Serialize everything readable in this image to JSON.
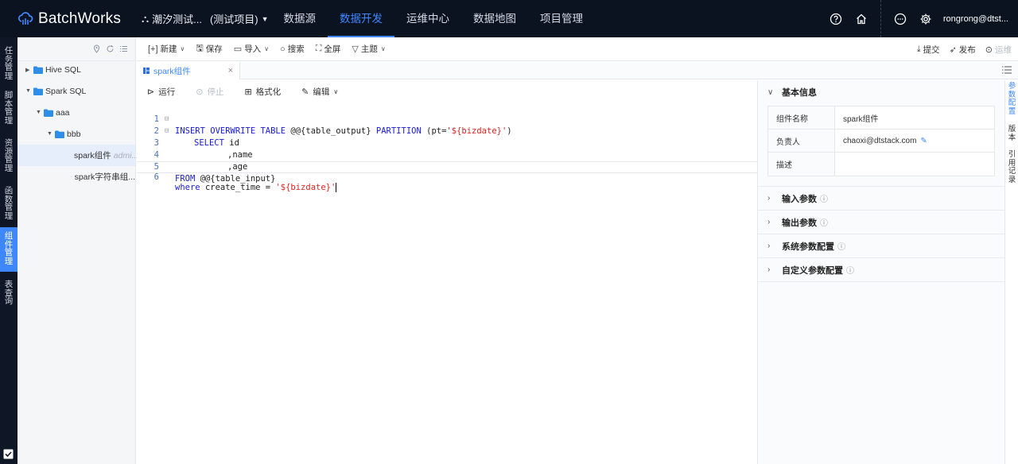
{
  "app": {
    "name": "BatchWorks",
    "project": "潮汐测试...",
    "project_tag": "(测试项目)",
    "user": "rongrong@dtst..."
  },
  "topnav": [
    "数据源",
    "数据开发",
    "运维中心",
    "数据地图",
    "项目管理"
  ],
  "leftbar": [
    [
      "任",
      "务",
      "管",
      "理"
    ],
    [
      "脚",
      "本",
      "管",
      "理"
    ],
    [
      "资",
      "源",
      "管",
      "理"
    ],
    [
      "函",
      "数",
      "管",
      "理"
    ],
    [
      "组",
      "件",
      "管",
      "理"
    ],
    [
      "表",
      "查",
      "询"
    ]
  ],
  "tree": {
    "hive": "Hive SQL",
    "spark": "Spark SQL",
    "aaa": "aaa",
    "bbb": "bbb",
    "file1": "spark组件",
    "file1_owner": "admi...",
    "file2": "spark字符串组..."
  },
  "toolbar": {
    "new": "新建",
    "save": "保存",
    "import": "导入",
    "search": "搜索",
    "fullscreen": "全屏",
    "theme": "主题",
    "submit": "提交",
    "publish": "发布",
    "ops": "运维"
  },
  "tab": {
    "label": "spark组件",
    "close": "×"
  },
  "editor_toolbar": {
    "run": "运行",
    "stop": "停止",
    "format": "格式化",
    "edit": "编辑"
  },
  "code": {
    "l1_kw": "INSERT OVERWRITE TABLE",
    "l1_mid": "@@{table_output}",
    "l1_kw2": "PARTITION",
    "l1_a": "(pt=",
    "l1_str": "'${bizdate}'",
    "l1_b": ")",
    "l2_kw": "SELECT",
    "l2_rest": "id",
    "l3": ",name",
    "l4": ",age",
    "l5_kw": "FROM",
    "l5_rest": "@@{table_input}",
    "l6_kw": "where",
    "l6_rest": "create_time =",
    "l6_str": "'${bizdate}'"
  },
  "line_numbers": [
    "1",
    "2",
    "3",
    "4",
    "5",
    "6"
  ],
  "info": {
    "title": "基本信息",
    "rows": [
      {
        "key": "组件名称",
        "value": "spark组件"
      },
      {
        "key": "负责人",
        "value": "chaoxi@dtstack.com"
      },
      {
        "key": "描述",
        "value": ""
      }
    ],
    "sections": [
      "输入参数",
      "输出参数",
      "系统参数配置",
      "自定义参数配置"
    ]
  },
  "vtabs": [
    [
      "参",
      "数",
      "配",
      "置"
    ],
    [
      "版",
      "本"
    ],
    [
      "引",
      "用",
      "记",
      "录"
    ]
  ]
}
